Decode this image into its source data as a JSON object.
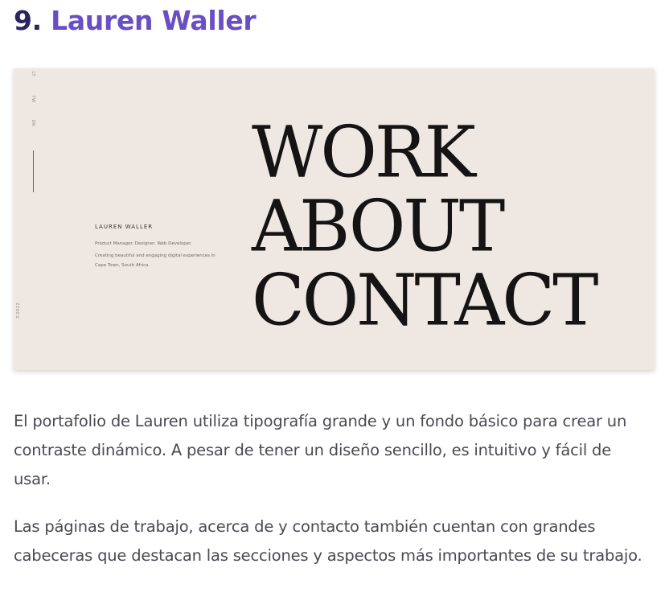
{
  "heading": {
    "number": "9.",
    "name": "Lauren Waller"
  },
  "screenshot": {
    "side_nav": [
      "LT",
      "TW",
      "DR"
    ],
    "year": "©2022",
    "bio": {
      "name": "LAUREN WALLER",
      "roles": "Product Manager. Designer. Web Developer.",
      "tagline": "Creating beautiful and engaging digital experiences in Cape Town, South Africa."
    },
    "big_nav": [
      "WORK",
      "ABOUT",
      "CONTACT"
    ]
  },
  "paragraphs": {
    "p1": "El portafolio de Lauren utiliza tipografía grande y un fondo básico para crear un contraste dinámico. A pesar de tener un diseño sencillo, es intuitivo y fácil de usar.",
    "p2": "Las páginas de trabajo, acerca de y contacto también cuentan con grandes cabeceras que destacan las secciones y aspectos más importantes de su trabajo."
  },
  "colors": {
    "heading_number": "#2b2560",
    "heading_name": "#6a4fc4",
    "screenshot_bg": "#efe8e2",
    "big_text": "#151313",
    "body_text": "#4a4a55"
  }
}
